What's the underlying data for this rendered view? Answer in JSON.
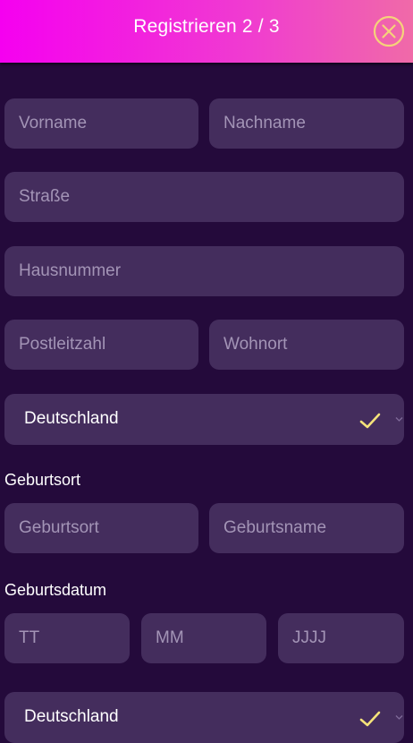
{
  "header": {
    "title": "Registrieren 2 / 3"
  },
  "form": {
    "first_name_placeholder": "Vorname",
    "last_name_placeholder": "Nachname",
    "street_placeholder": "Straße",
    "house_number_placeholder": "Hausnummer",
    "postal_code_placeholder": "Postleitzahl",
    "city_placeholder": "Wohnort",
    "country_value": "Deutschland",
    "birth_place_label": "Geburtsort",
    "birth_place_placeholder": "Geburtsort",
    "birth_name_placeholder": "Geburtsname",
    "birth_date_label": "Geburtsdatum",
    "day_placeholder": "TT",
    "month_placeholder": "MM",
    "year_placeholder": "JJJJ",
    "nationality_value": "Deutschland"
  },
  "colors": {
    "header_gradient_start": "#f500f0",
    "header_gradient_end": "#f06aa8",
    "background": "#240a3b",
    "field_background": "#442d5d",
    "placeholder": "#a394b6",
    "check": "#f5e37a"
  },
  "icons": {
    "close": "close-circle-icon",
    "valid": "checkmark-icon",
    "dropdown": "chevron-down-icon"
  }
}
